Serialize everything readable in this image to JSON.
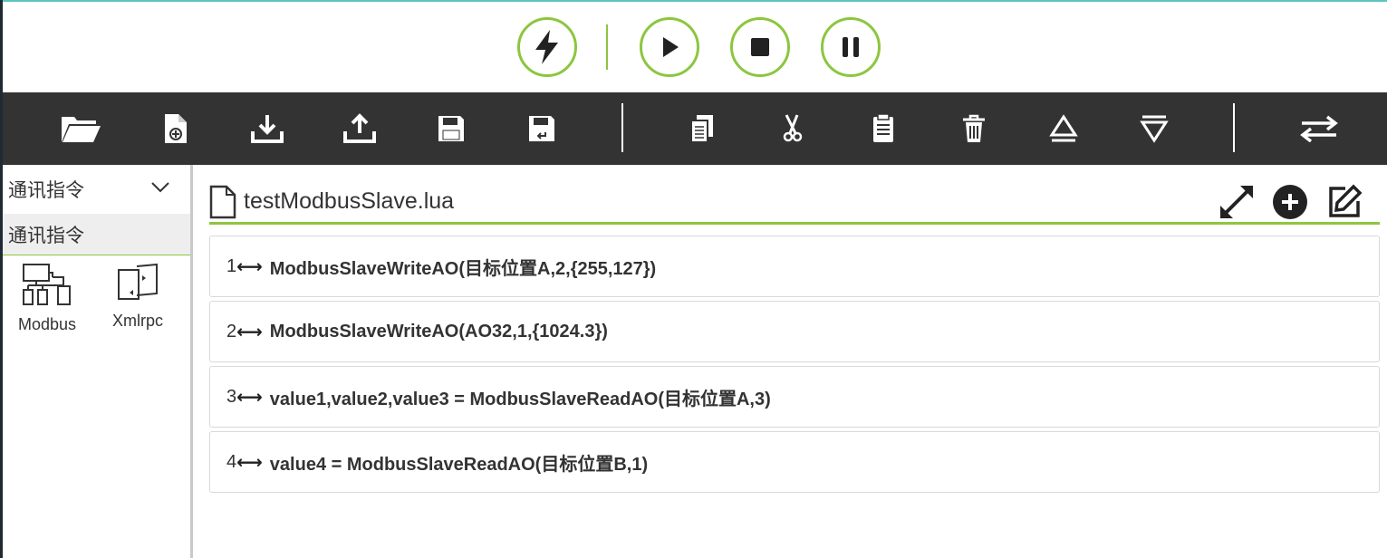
{
  "run_controls": {
    "items": [
      {
        "name": "lightning-icon"
      },
      {
        "name": "play-icon"
      },
      {
        "name": "stop-icon"
      },
      {
        "name": "pause-icon"
      }
    ],
    "accent_color": "#8cc63f"
  },
  "toolbar": {
    "background": "#333333",
    "items": [
      {
        "name": "folder-icon"
      },
      {
        "name": "new-file-icon"
      },
      {
        "name": "download-icon"
      },
      {
        "name": "upload-icon"
      },
      {
        "name": "save-icon"
      },
      {
        "name": "save-as-icon"
      },
      {
        "name": "copy-icon"
      },
      {
        "name": "cut-icon"
      },
      {
        "name": "paste-icon"
      },
      {
        "name": "delete-icon"
      },
      {
        "name": "move-up-icon"
      },
      {
        "name": "move-down-icon"
      },
      {
        "name": "swap-icon"
      }
    ]
  },
  "sidebar": {
    "category_select": "通讯指令",
    "category_header": "通讯指令",
    "commands": [
      {
        "label": "Modbus",
        "icon": "modbus-icon"
      },
      {
        "label": "Xmlrpc",
        "icon": "xmlrpc-icon"
      }
    ]
  },
  "editor": {
    "file_name": "testModbusSlave.lua",
    "header_buttons": [
      {
        "name": "expand-icon"
      },
      {
        "name": "add-icon"
      },
      {
        "name": "edit-icon"
      }
    ],
    "lines": [
      {
        "num": "1",
        "arrow": "⟷",
        "code": "ModbusSlaveWriteAO(目标位置A,2,{255,127})"
      },
      {
        "num": "2",
        "arrow": "⟷",
        "code": "ModbusSlaveWriteAO(AO32,1,{1024.3})"
      },
      {
        "num": "3",
        "arrow": "⟷",
        "code": "value1,value2,value3 = ModbusSlaveReadAO(目标位置A,3)"
      },
      {
        "num": "4",
        "arrow": "⟷",
        "code": "value4 = ModbusSlaveReadAO(目标位置B,1)"
      }
    ]
  }
}
